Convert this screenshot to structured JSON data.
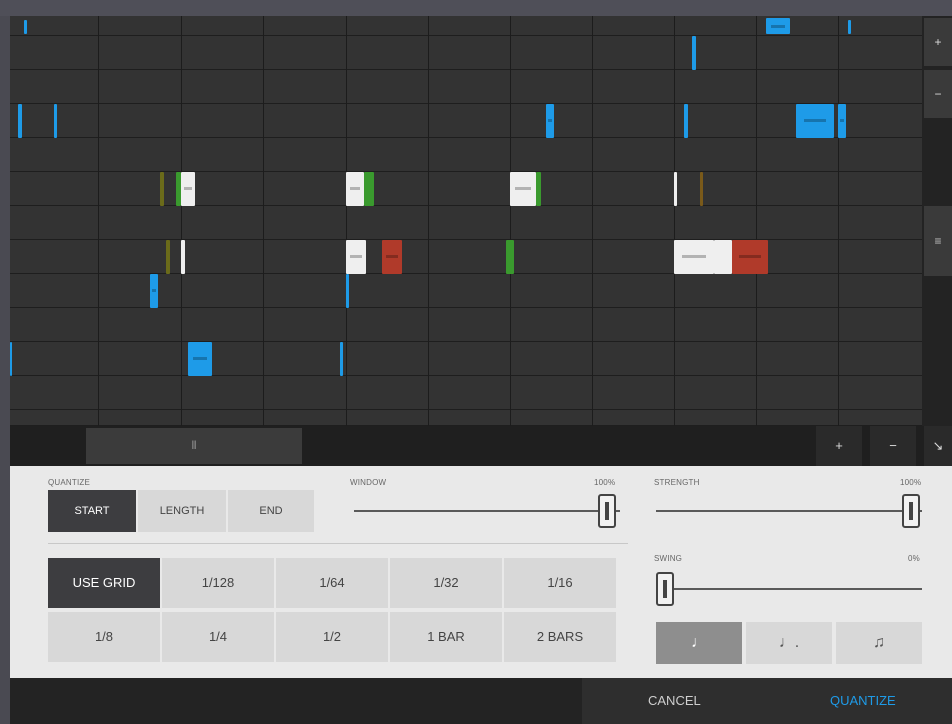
{
  "editor": {
    "right_controls": {
      "zoom_in": "+",
      "zoom_out": "−",
      "handle": "≡"
    },
    "scroll": {
      "thumb": "⦀",
      "zoom_in": "+",
      "zoom_out": "−",
      "expand": "↘"
    }
  },
  "notes": [
    {
      "color": "#1e9be8"
    },
    {
      "color": "#1e9be8"
    },
    {
      "color": "#1e9be8"
    },
    {
      "color": "#1e9be8"
    },
    {
      "color": "#1e9be8"
    },
    {
      "color": "#1e9be8"
    },
    {
      "color": "#1e9be8"
    },
    {
      "color": "#1e9be8"
    },
    {
      "color": "#1e9be8"
    },
    {
      "color": "#1e9be8"
    },
    {
      "color": "#1e9be8"
    },
    {
      "color": "#6b6b1a"
    },
    {
      "color": "#3a9a2e"
    },
    {
      "color": "#efefef"
    },
    {
      "color": "#efefef"
    },
    {
      "color": "#3a9a2e"
    },
    {
      "color": "#efefef"
    },
    {
      "color": "#3a9a2e"
    },
    {
      "color": "#efefef"
    },
    {
      "color": "#7a5a1a"
    },
    {
      "color": "#6b6b1a"
    },
    {
      "color": "#efefef"
    },
    {
      "color": "#efefef"
    },
    {
      "color": "#b03a2a"
    },
    {
      "color": "#3a9a2e"
    },
    {
      "color": "#efefef"
    },
    {
      "color": "#efefef"
    },
    {
      "color": "#b03a2a"
    },
    {
      "color": "#1e9be8"
    },
    {
      "color": "#1e9be8"
    },
    {
      "color": "#1e9be8"
    },
    {
      "color": "#1e9be8"
    }
  ],
  "quantize": {
    "label": "QUANTIZE",
    "modes": [
      "START",
      "LENGTH",
      "END"
    ],
    "active_mode": "START"
  },
  "window": {
    "label": "WINDOW",
    "value_text": "100%",
    "level": 1.0
  },
  "strength": {
    "label": "STRENGTH",
    "value_text": "100%",
    "level": 1.0
  },
  "swing": {
    "label": "SWING",
    "value_text": "0%",
    "level": 0.0
  },
  "grid": {
    "buttons": [
      "USE GRID",
      "1/128",
      "1/64",
      "1/32",
      "1/16",
      "1/8",
      "1/4",
      "1/2",
      "1 BAR",
      "2 BARS"
    ],
    "active": "USE GRID"
  },
  "note_types": [
    {
      "icon": "quarter-note-icon",
      "glyph": "♩",
      "active": true
    },
    {
      "icon": "dotted-note-icon",
      "glyph": "♩.",
      "active": false
    },
    {
      "icon": "triplet-note-icon",
      "glyph": "♫",
      "active": false
    }
  ],
  "actions": {
    "cancel": "CANCEL",
    "quantize": "QUANTIZE"
  },
  "colors": {
    "accent": "#1e9be8",
    "panel_bg": "#e9e9e9",
    "editor_bg": "#2c2c2c"
  }
}
